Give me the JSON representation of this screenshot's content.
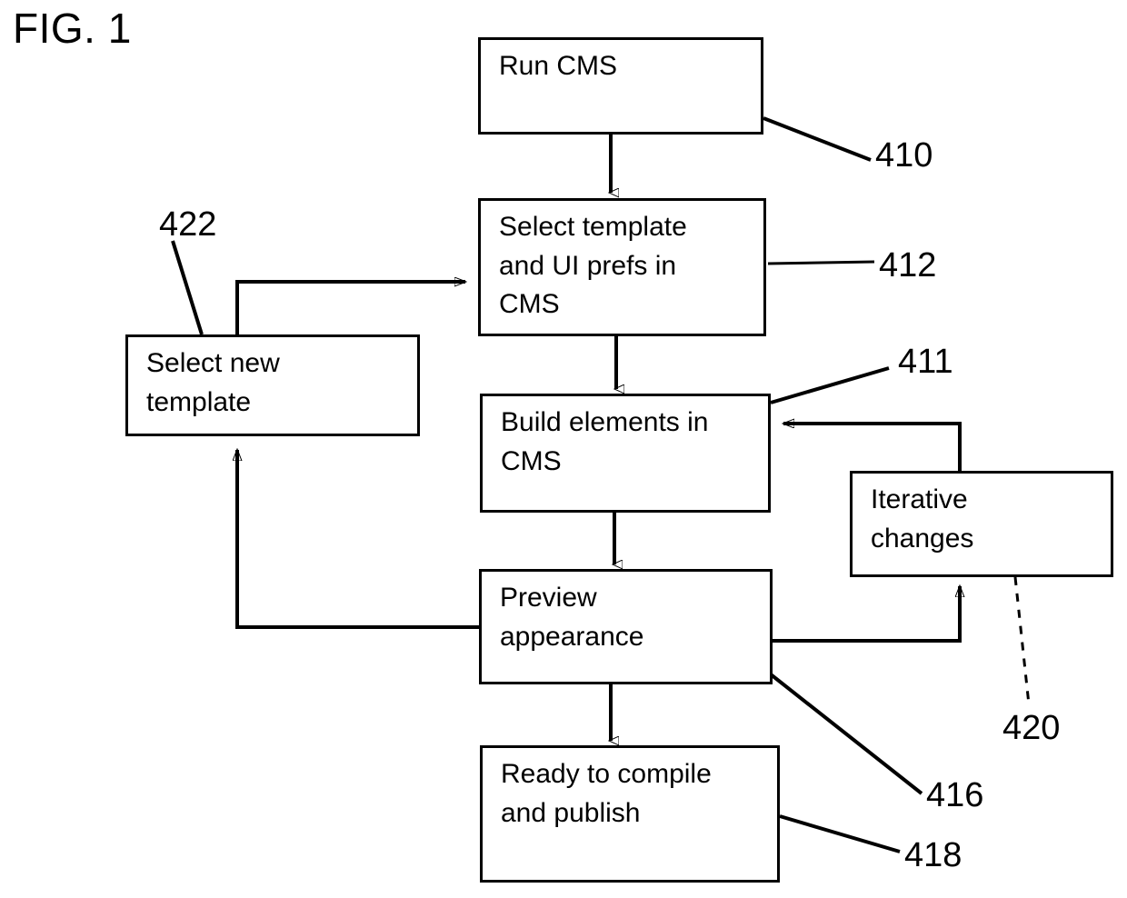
{
  "figure": {
    "title": "FIG. 1",
    "type": "patent-flowchart",
    "background_color": "#ffffff",
    "stroke_color": "#000000"
  },
  "boxes": [
    {
      "id": "run-cms",
      "label": "Run CMS",
      "ref": "410"
    },
    {
      "id": "select-template",
      "label": "Select template\nand UI prefs in\nCMS",
      "ref": "412"
    },
    {
      "id": "build-elements",
      "label": "Build elements in\nCMS",
      "ref": "411"
    },
    {
      "id": "preview",
      "label": "Preview\nappearance",
      "ref": "416"
    },
    {
      "id": "ready",
      "label": "Ready to compile\nand publish",
      "ref": "418"
    },
    {
      "id": "select-new",
      "label": "Select new\ntemplate",
      "ref": "422"
    },
    {
      "id": "iterative",
      "label": "Iterative\nchanges",
      "ref": "420"
    }
  ],
  "reference_numerals": {
    "n410": "410",
    "n411": "411",
    "n412": "412",
    "n416": "416",
    "n418": "418",
    "n420": "420",
    "n422": "422"
  },
  "connections": [
    {
      "from": "run-cms",
      "to": "select-template",
      "style": "solid-arrow",
      "direction": "down"
    },
    {
      "from": "select-template",
      "to": "build-elements",
      "style": "solid-arrow",
      "direction": "down"
    },
    {
      "from": "build-elements",
      "to": "preview",
      "style": "solid-arrow",
      "direction": "down"
    },
    {
      "from": "preview",
      "to": "ready",
      "style": "solid-arrow",
      "direction": "down"
    },
    {
      "from": "preview",
      "to": "iterative",
      "style": "solid-arrow",
      "direction": "right-up"
    },
    {
      "from": "iterative",
      "to": "build-elements",
      "style": "solid-arrow",
      "direction": "up-left"
    },
    {
      "from": "preview",
      "to": "select-new",
      "style": "solid-arrow",
      "direction": "left-up"
    },
    {
      "from": "select-new",
      "to": "select-template",
      "style": "solid-arrow",
      "direction": "up-right"
    }
  ],
  "leader_lines": [
    {
      "ref": "410",
      "target": "run-cms",
      "line_style": "solid"
    },
    {
      "ref": "411",
      "target": "build-elements",
      "line_style": "solid"
    },
    {
      "ref": "412",
      "target": "select-template",
      "line_style": "solid"
    },
    {
      "ref": "416",
      "target": "preview",
      "line_style": "solid"
    },
    {
      "ref": "418",
      "target": "ready",
      "line_style": "solid"
    },
    {
      "ref": "420",
      "target": "iterative",
      "line_style": "dashed"
    },
    {
      "ref": "422",
      "target": "select-new",
      "line_style": "solid"
    }
  ]
}
